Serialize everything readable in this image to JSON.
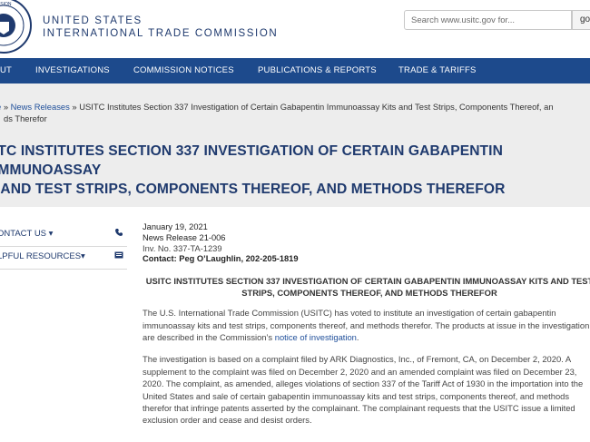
{
  "header": {
    "agency_line1": "UNITED STATES",
    "agency_line2": "INTERNATIONAL TRADE COMMISSION",
    "search_placeholder": "Search www.usitc.gov for...",
    "search_button": "go"
  },
  "nav": {
    "items": [
      "UT",
      "INVESTIGATIONS",
      "COMMISSION NOTICES",
      "PUBLICATIONS & REPORTS",
      "TRADE & TARIFFS"
    ]
  },
  "breadcrumb": {
    "home": "e",
    "separator": "»",
    "news": "News Releases",
    "current_line1": "USITC Institutes Section 337 Investigation of Certain Gabapentin Immunoassay Kits and Test Strips, Components Thereof, an",
    "current_line2": "ds Therefor"
  },
  "page_title": {
    "line1": "ITC INSTITUTES SECTION 337 INVESTIGATION OF CERTAIN GABAPENTIN IMMUNOASSAY",
    "line2": "S AND TEST STRIPS, COMPONENTS THEREOF, AND METHODS THEREFOR"
  },
  "sidebar": {
    "contact": "ONTACT US ▾",
    "resources": "LPFUL RESOURCES▾"
  },
  "release": {
    "date": "January 19, 2021",
    "number": "News Release 21-006",
    "inv": "Inv. No. 337-TA-1239",
    "contact": "Contact: Peg O’Laughlin, 202-205-1819",
    "subtitle": "USITC INSTITUTES SECTION 337 INVESTIGATION OF CERTAIN GABAPENTIN IMMUNOASSAY KITS AND TEST STRIPS, COMPONENTS THEREOF, AND METHODS THEREFOR",
    "p1_text": "The U.S. International Trade Commission (USITC) has voted to institute an investigation of certain gabapentin immunoassay kits and test strips, components thereof, and methods therefor.  The products at issue in the investigation are described in the Commission’s ",
    "p1_link": "notice of investigation",
    "p1_end": ".",
    "p2": "The investigation is based on a complaint filed by ARK Diagnostics, Inc., of Fremont, CA, on December 2, 2020.  A supplement to the complaint was filed on December 2, 2020 and an amended complaint was filed on December 23, 2020.  The complaint, as amended, alleges violations of section 337 of the Tariff Act of 1930 in the importation into the United States and sale of certain gabapentin immunoassay kits and test strips, components thereof, and methods therefor that infringe patents asserted by the complainant.  The complainant requests that the USITC issue a limited exclusion order and cease and desist orders."
  },
  "colors": {
    "nav_bg": "#1d4a8c",
    "title": "#1f3a6e",
    "link": "#1f4f9a",
    "banner_bg": "#ededed"
  }
}
